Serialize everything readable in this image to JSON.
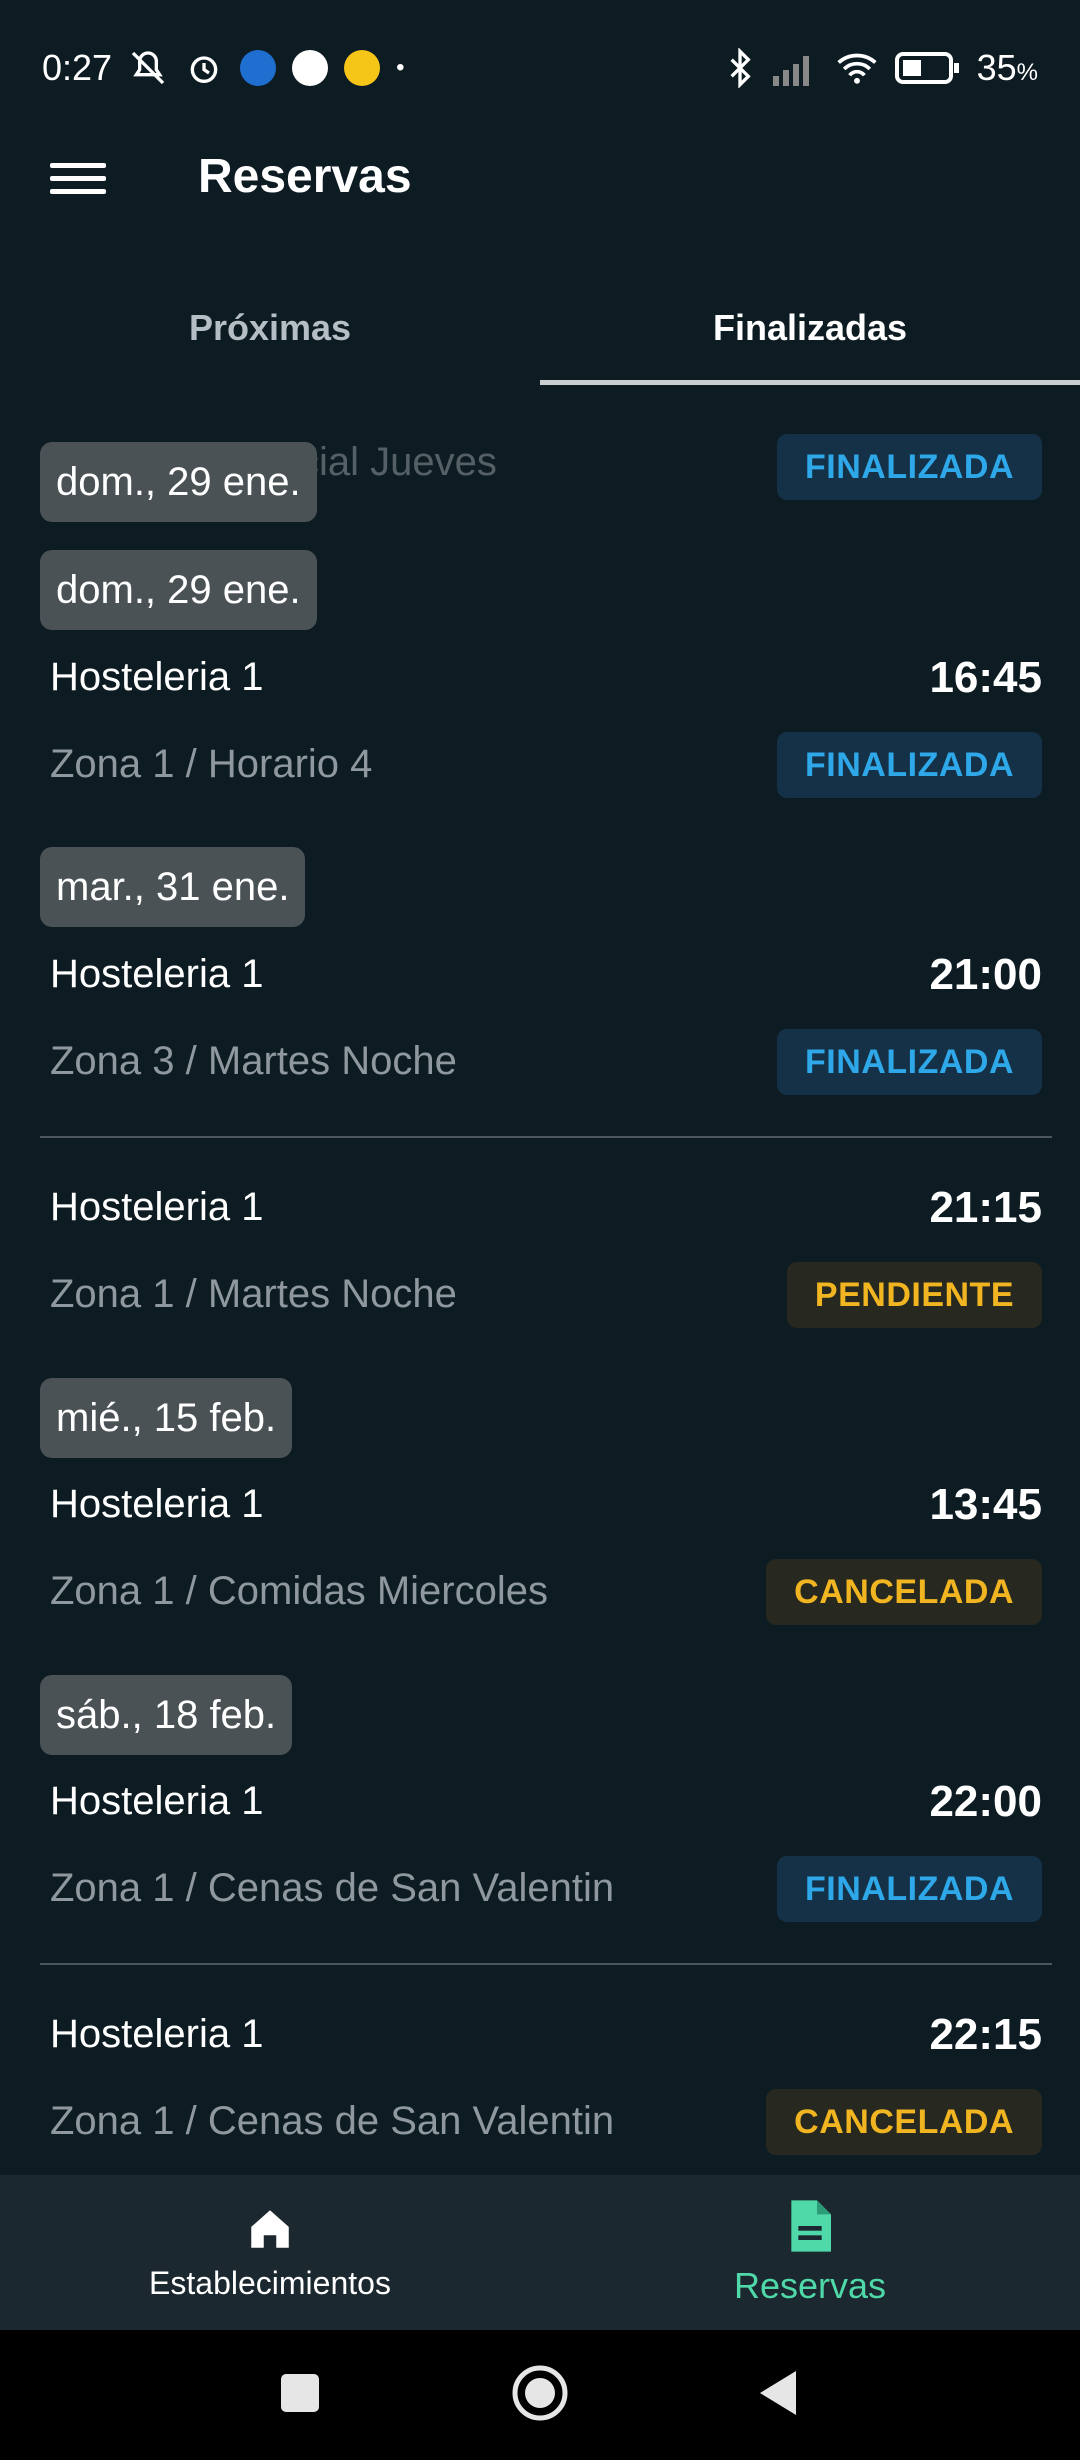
{
  "status_bar": {
    "time": "0:27",
    "battery": "35",
    "battery_unit": "%",
    "left_icons": [
      "mute-icon",
      "alarm-icon",
      "outlook-icon",
      "google-icon",
      "app-icon",
      "dot-icon"
    ],
    "right_icons": [
      "bluetooth-icon",
      "signal-icon",
      "wifi-icon",
      "battery-icon"
    ]
  },
  "app_bar": {
    "title": "Reservas",
    "menu_icon": "menu-icon"
  },
  "tabs": [
    {
      "label": "Próximas",
      "active": false
    },
    {
      "label": "Finalizadas",
      "active": true
    }
  ],
  "reservations": {
    "partial": {
      "sub": "Zona 1  /  Especial Jueves",
      "status": "FINALIZADA",
      "sticky_date": "dom., 29 ene."
    },
    "groups": [
      {
        "date": "dom., 29 ene.",
        "items": [
          {
            "title": "Hosteleria 1",
            "time": "16:45",
            "sub": "Zona 1  /  Horario 4",
            "status": "FINALIZADA"
          }
        ]
      },
      {
        "date": "mar., 31 ene.",
        "items": [
          {
            "title": "Hosteleria 1",
            "time": "21:00",
            "sub": "Zona 3  /  Martes Noche",
            "status": "FINALIZADA"
          },
          {
            "title": "Hosteleria 1",
            "time": "21:15",
            "sub": "Zona 1  /  Martes Noche",
            "status": "PENDIENTE"
          }
        ]
      },
      {
        "date": "mié., 15 feb.",
        "items": [
          {
            "title": "Hosteleria 1",
            "time": "13:45",
            "sub": "Zona 1  /  Comidas Miercoles",
            "status": "CANCELADA"
          }
        ]
      },
      {
        "date": "sáb., 18 feb.",
        "items": [
          {
            "title": "Hosteleria 1",
            "time": "22:00",
            "sub": "Zona 1  /  Cenas de San Valentin",
            "status": "FINALIZADA"
          },
          {
            "title": "Hosteleria 1",
            "time": "22:15",
            "sub": "Zona 1  /  Cenas de San Valentin",
            "status": "CANCELADA"
          }
        ]
      }
    ]
  },
  "bottom_nav": [
    {
      "label": "Establecimientos",
      "icon": "home-icon",
      "active": false
    },
    {
      "label": "Reservas",
      "icon": "document-icon",
      "active": true
    }
  ],
  "colors": {
    "background": "#0d1b22",
    "finalizada": "#2ea8e8",
    "pendiente": "#f0b521",
    "cancelada": "#f0b521",
    "active_nav": "#4fd9a8"
  }
}
